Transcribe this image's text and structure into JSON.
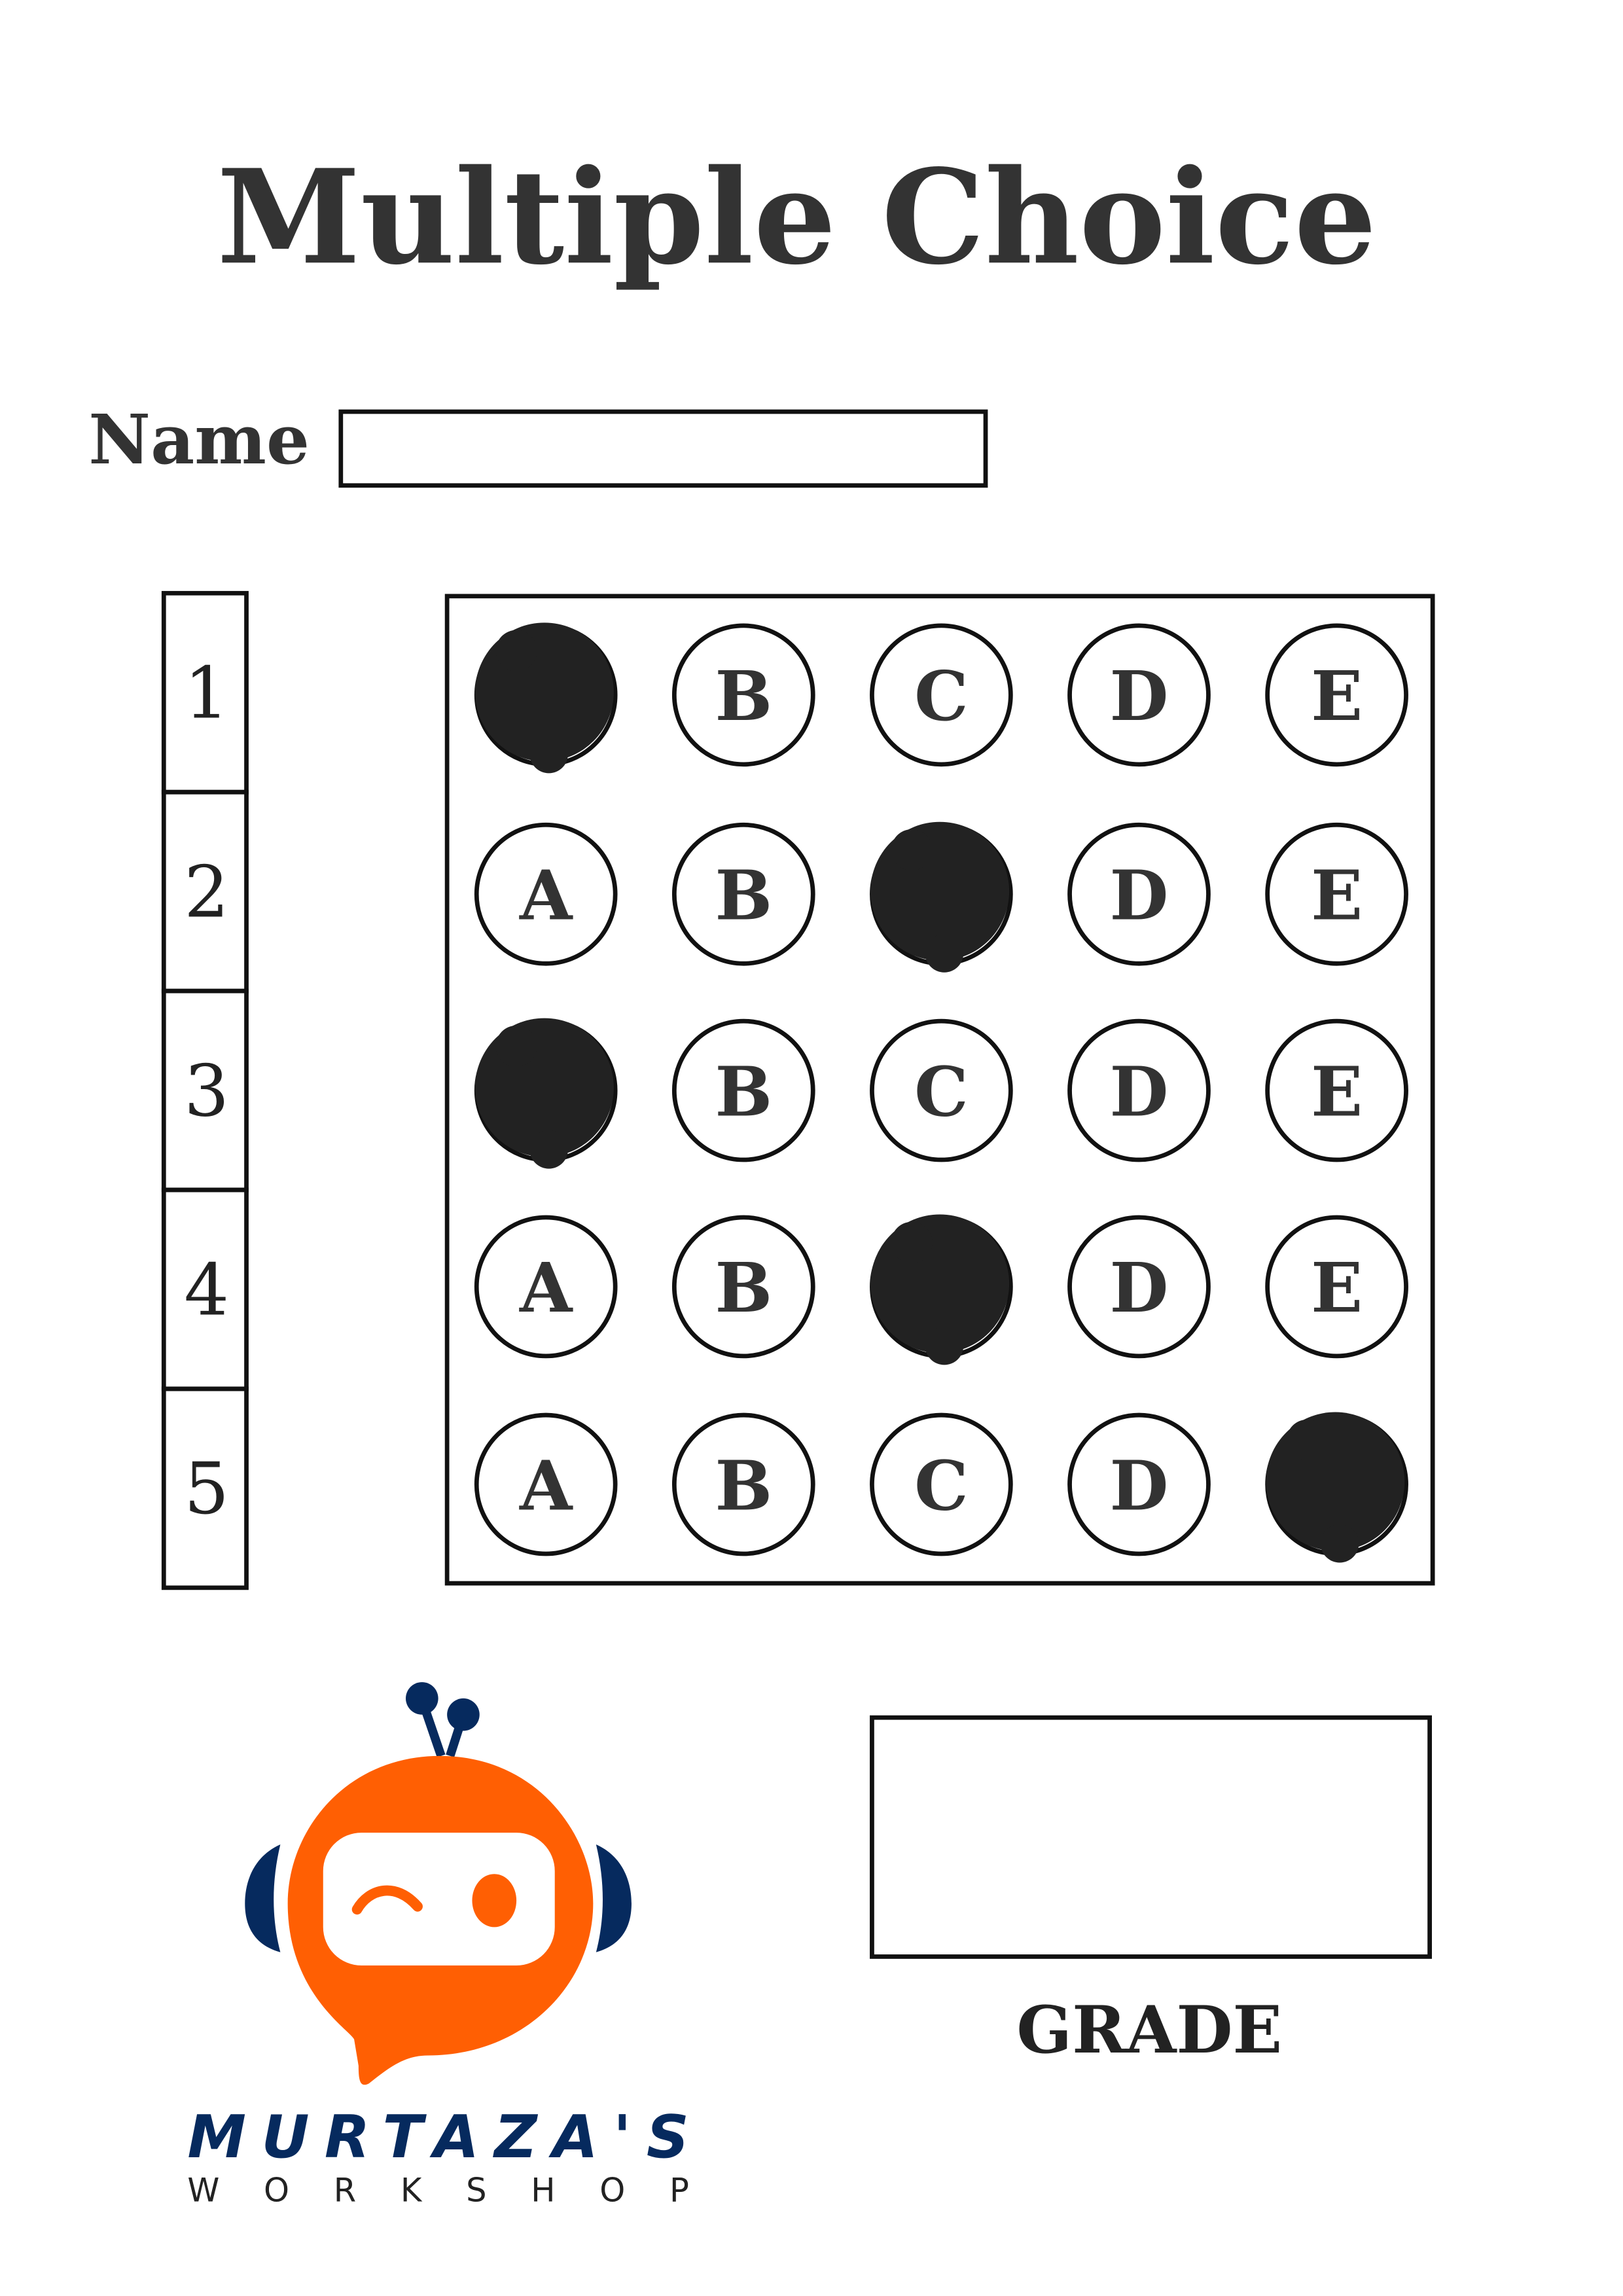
{
  "title": "Multiple Choice",
  "name_label": "Name",
  "name_value": "",
  "grade_label": "GRADE",
  "grade_value": "",
  "options": [
    "A",
    "B",
    "C",
    "D",
    "E"
  ],
  "questions": [
    {
      "number": "1",
      "marked": "A"
    },
    {
      "number": "2",
      "marked": "C"
    },
    {
      "number": "3",
      "marked": "A"
    },
    {
      "number": "4",
      "marked": "C"
    },
    {
      "number": "5",
      "marked": "E"
    }
  ],
  "logo": {
    "name": "MURTAZA'S",
    "subtitle": "W O R K S H O P"
  },
  "colors": {
    "ink": "#222222",
    "title": "#333333",
    "logo_orange": "#FF5F03",
    "logo_navy": "#062A5E"
  }
}
